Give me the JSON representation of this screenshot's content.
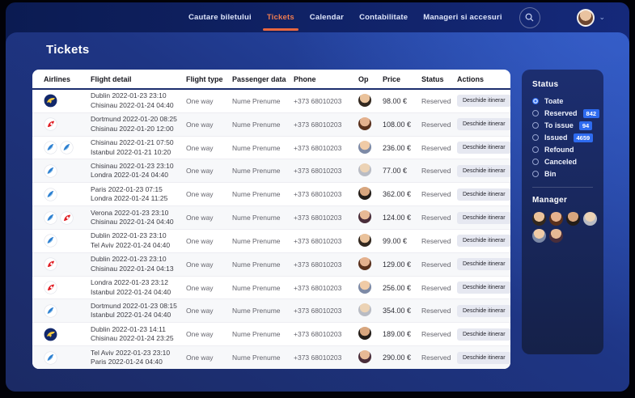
{
  "nav": {
    "items": [
      "Cautare biletului",
      "Tickets",
      "Calendar",
      "Contabilitate",
      "Manageri si accesuri"
    ],
    "active_item": "Tickets"
  },
  "page": {
    "title": "Tickets"
  },
  "table": {
    "columns": [
      "Airlines",
      "Flight detail",
      "Flight type",
      "Passenger data",
      "Phone",
      "Op",
      "Price",
      "Status",
      "Actions"
    ],
    "action_label": "Deschide itinerar",
    "rows": [
      {
        "airlines": [
          "ryanair"
        ],
        "from": "Dublin 2022-01-23 23:10",
        "to": "Chisinau 2022-01-24 04:40",
        "flight_type": "One way",
        "passenger": "Nume Prenume",
        "phone": "+373 68010203",
        "price": "98.00 €",
        "status": "Reserved"
      },
      {
        "airlines": [
          "swiss"
        ],
        "from": "Dortmund 2022-01-20 08:25",
        "to": "Chisinau 2022-01-20 12:00",
        "flight_type": "One way",
        "passenger": "Nume Prenume",
        "phone": "+373 68010203",
        "price": "108.00 €",
        "status": "Reserved"
      },
      {
        "airlines": [
          "blue",
          "blue"
        ],
        "from": "Chisinau 2022-01-21 07:50",
        "to": "Istanbul 2022-01-21 10:20",
        "flight_type": "One way",
        "passenger": "Nume Prenume",
        "phone": "+373 68010203",
        "price": "236.00 €",
        "status": "Reserved"
      },
      {
        "airlines": [
          "blue"
        ],
        "from": "Chisinau 2022-01-23 23:10",
        "to": "Londra 2022-01-24 04:40",
        "flight_type": "One way",
        "passenger": "Nume Prenume",
        "phone": "+373 68010203",
        "price": "77.00 €",
        "status": "Reserved"
      },
      {
        "airlines": [
          "blue"
        ],
        "from": "Paris 2022-01-23 07:15",
        "to": "Londra 2022-01-24 11:25",
        "flight_type": "One way",
        "passenger": "Nume Prenume",
        "phone": "+373 68010203",
        "price": "362.00 €",
        "status": "Reserved"
      },
      {
        "airlines": [
          "blue",
          "swiss"
        ],
        "from": "Verona 2022-01-23 23:10",
        "to": "Chisinau 2022-01-24 04:40",
        "flight_type": "One way",
        "passenger": "Nume Prenume",
        "phone": "+373 68010203",
        "price": "124.00 €",
        "status": "Reserved"
      },
      {
        "airlines": [
          "blue"
        ],
        "from": "Dublin 2022-01-23 23:10",
        "to": "Tel Aviv 2022-01-24 04:40",
        "flight_type": "One way",
        "passenger": "Nume Prenume",
        "phone": "+373 68010203",
        "price": "99.00 €",
        "status": "Reserved"
      },
      {
        "airlines": [
          "swiss"
        ],
        "from": "Dublin 2022-01-23 23:10",
        "to": "Chisinau 2022-01-24 04:13",
        "flight_type": "One way",
        "passenger": "Nume Prenume",
        "phone": "+373 68010203",
        "price": "129.00 €",
        "status": "Reserved"
      },
      {
        "airlines": [
          "swiss"
        ],
        "from": "Londra 2022-01-23 23:12",
        "to": "Istanbul 2022-01-24 04:40",
        "flight_type": "One way",
        "passenger": "Nume Prenume",
        "phone": "+373 68010203",
        "price": "256.00 €",
        "status": "Reserved"
      },
      {
        "airlines": [
          "blue"
        ],
        "from": "Dortmund 2022-01-23 08:15",
        "to": "Istanbul 2022-01-24 04:40",
        "flight_type": "One way",
        "passenger": "Nume Prenume",
        "phone": "+373 68010203",
        "price": "354.00 €",
        "status": "Reserved"
      },
      {
        "airlines": [
          "ryanair"
        ],
        "from": "Dublin 2022-01-23 14:11",
        "to": "Chisinau 2022-01-24 23:25",
        "flight_type": "One way",
        "passenger": "Nume Prenume",
        "phone": "+373 68010203",
        "price": "189.00 €",
        "status": "Reserved"
      },
      {
        "airlines": [
          "blue"
        ],
        "from": "Tel Aviv 2022-01-23 23:10",
        "to": "Paris 2022-01-24 04:40",
        "flight_type": "One way",
        "passenger": "Nume Prenume",
        "phone": "+373 68010203",
        "price": "290.00 €",
        "status": "Reserved"
      }
    ]
  },
  "sidebar": {
    "status_title": "Status",
    "options": [
      {
        "label": "Toate",
        "selected": true,
        "count": ""
      },
      {
        "label": "Reserved",
        "selected": false,
        "count": "842"
      },
      {
        "label": "To issue",
        "selected": false,
        "count": "94"
      },
      {
        "label": "Issued",
        "selected": false,
        "count": "4659"
      },
      {
        "label": "Refound",
        "selected": false,
        "count": ""
      },
      {
        "label": "Canceled",
        "selected": false,
        "count": ""
      },
      {
        "label": "Bin",
        "selected": false,
        "count": ""
      }
    ],
    "manager_title": "Manager",
    "manager_count": "6"
  },
  "colors": {
    "accent_orange": "#e8673f",
    "badge_blue": "#2e6bf0",
    "topbar_navy": "#0e2063",
    "panel_blue": "#1e3584",
    "sidebar_navy": "#1b2d6d",
    "ryanair_navy": "#12286b",
    "ryanair_yellow": "#f2c93f",
    "swiss_red": "#e01b22",
    "airline_blue": "#2b7fd0"
  }
}
